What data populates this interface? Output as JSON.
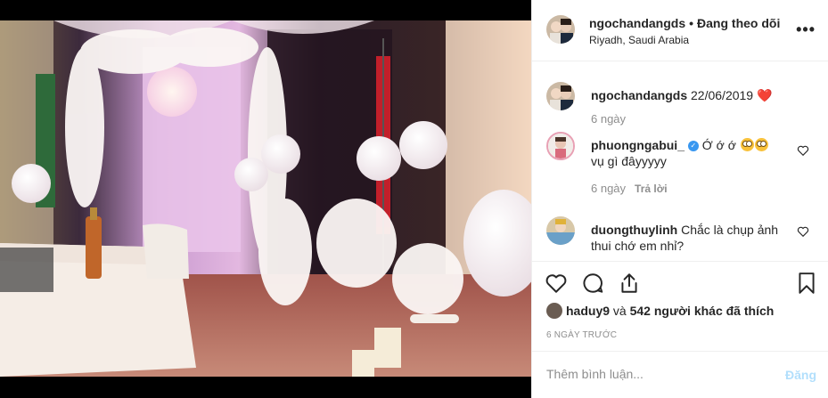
{
  "header": {
    "username": "ngochandangds",
    "separator": "•",
    "follow_status": "Đang theo dõi",
    "location": "Riyadh, Saudi Arabia",
    "more_icon": "more-horizontal-icon"
  },
  "comments": [
    {
      "username": "ngochandangds",
      "text": "22/06/2019",
      "emoji": "❤️",
      "time": "6 ngày"
    },
    {
      "username": "phuongngabui_",
      "verified": true,
      "text": "Ớ ớ ớ",
      "text2": "vụ gì đâyyyyy",
      "time": "6 ngày",
      "reply_label": "Trả lời"
    },
    {
      "username": "duongthuylinh",
      "text": "Chắc là chụp ảnh thui chớ em nhỉ?"
    }
  ],
  "actions": {
    "like_icon": "heart-icon",
    "comment_icon": "comment-icon",
    "share_icon": "share-icon",
    "save_icon": "bookmark-icon"
  },
  "likes": {
    "first_user": "haduy9",
    "connector": "và",
    "others": "542 người khác",
    "suffix": "đã thích"
  },
  "post_date": "6 NGÀY TRƯỚC",
  "comment_box": {
    "placeholder": "Thêm bình luận...",
    "post_label": "Đăng"
  },
  "colors": {
    "accent_blue": "#3897f0",
    "post_disabled": "#b2dffc",
    "muted": "#8e8e8e",
    "border": "#efefef"
  }
}
